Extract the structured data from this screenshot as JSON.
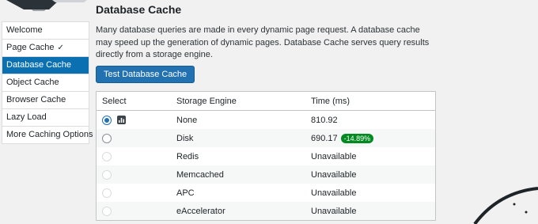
{
  "sidebar": {
    "items": [
      {
        "label": "Welcome"
      },
      {
        "label": "Page Cache",
        "check": "✓"
      },
      {
        "label": "Database Cache"
      },
      {
        "label": "Object Cache"
      },
      {
        "label": "Browser Cache"
      },
      {
        "label": "Lazy Load"
      },
      {
        "label": "More Caching Options"
      }
    ]
  },
  "main": {
    "title": "Database Cache",
    "description": "Many database queries are made in every dynamic page request. A database cache may speed up the generation of dynamic pages. Database Cache serves query results directly from a storage engine.",
    "test_button": "Test Database Cache",
    "table": {
      "headers": [
        "Select",
        "Storage Engine",
        "Time (ms)"
      ],
      "rows": [
        {
          "engine": "None",
          "time": "810.92"
        },
        {
          "engine": "Disk",
          "time": "690.17",
          "badge": "-14.89%"
        },
        {
          "engine": "Redis",
          "time": "Unavailable"
        },
        {
          "engine": "Memcached",
          "time": "Unavailable"
        },
        {
          "engine": "APC",
          "time": "Unavailable"
        },
        {
          "engine": "eAccelerator",
          "time": "Unavailable"
        }
      ]
    }
  },
  "colors": {
    "accent": "#2271b1",
    "sidebar_active": "#0b70b2",
    "badge_green": "#008a20"
  }
}
